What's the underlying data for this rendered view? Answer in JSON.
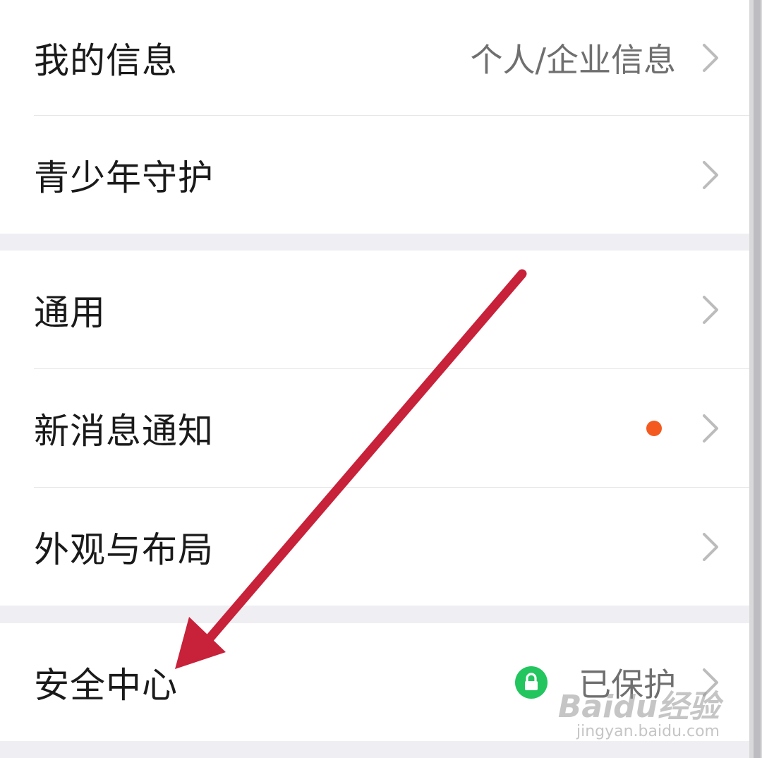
{
  "settings": {
    "group1": [
      {
        "label": "我的信息",
        "value": "个人/企业信息"
      },
      {
        "label": "青少年守护",
        "value": ""
      }
    ],
    "group2": [
      {
        "label": "通用",
        "value": ""
      },
      {
        "label": "新消息通知",
        "value": ""
      },
      {
        "label": "外观与布局",
        "value": ""
      }
    ],
    "group3": [
      {
        "label": "安全中心",
        "value": "已保护"
      }
    ]
  },
  "icons": {
    "chevron": "chevron-right-icon",
    "notification_dot": "notification-dot",
    "lock": "lock-icon"
  },
  "colors": {
    "annotation_arrow": "#c8213a",
    "notification_dot": "#f45a20",
    "secure_green": "#22c55e"
  },
  "watermark": {
    "brand": "Baidu经验",
    "url": "jingyan.baidu.com"
  }
}
